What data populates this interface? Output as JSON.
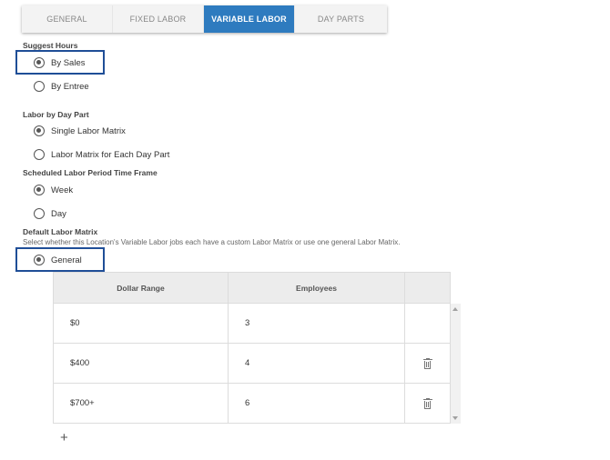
{
  "tabs": [
    {
      "label": "GENERAL",
      "active": false
    },
    {
      "label": "FIXED LABOR",
      "active": false
    },
    {
      "label": "VARIABLE LABOR",
      "active": true
    },
    {
      "label": "DAY PARTS",
      "active": false
    }
  ],
  "suggest_hours": {
    "title": "Suggest Hours",
    "options": [
      {
        "label": "By Sales",
        "checked": true
      },
      {
        "label": "By Entree",
        "checked": false
      }
    ]
  },
  "labor_by_day_part": {
    "title": "Labor by Day Part",
    "options": [
      {
        "label": "Single Labor Matrix",
        "checked": true
      },
      {
        "label": "Labor Matrix for Each Day Part",
        "checked": false
      }
    ]
  },
  "scheduled_period": {
    "title": "Scheduled Labor Period Time Frame",
    "options": [
      {
        "label": "Week",
        "checked": true
      },
      {
        "label": "Day",
        "checked": false
      }
    ]
  },
  "default_matrix": {
    "title": "Default Labor Matrix",
    "description": "Select whether this Location's Variable Labor jobs each have a custom Labor Matrix or use one general Labor Matrix.",
    "options": [
      {
        "label": "General",
        "checked": true
      }
    ]
  },
  "table": {
    "headers": [
      "Dollar Range",
      "Employees",
      ""
    ],
    "rows": [
      {
        "dollar_range": "$0",
        "employees": "3",
        "deletable": false
      },
      {
        "dollar_range": "$400",
        "employees": "4",
        "deletable": true
      },
      {
        "dollar_range": "$700+",
        "employees": "6",
        "deletable": true
      }
    ]
  },
  "add_label": "+",
  "colors": {
    "accent": "#2e7bbf",
    "highlight": "#1f4e97"
  },
  "icons": {
    "delete": "trash-icon",
    "add": "plus-icon"
  }
}
